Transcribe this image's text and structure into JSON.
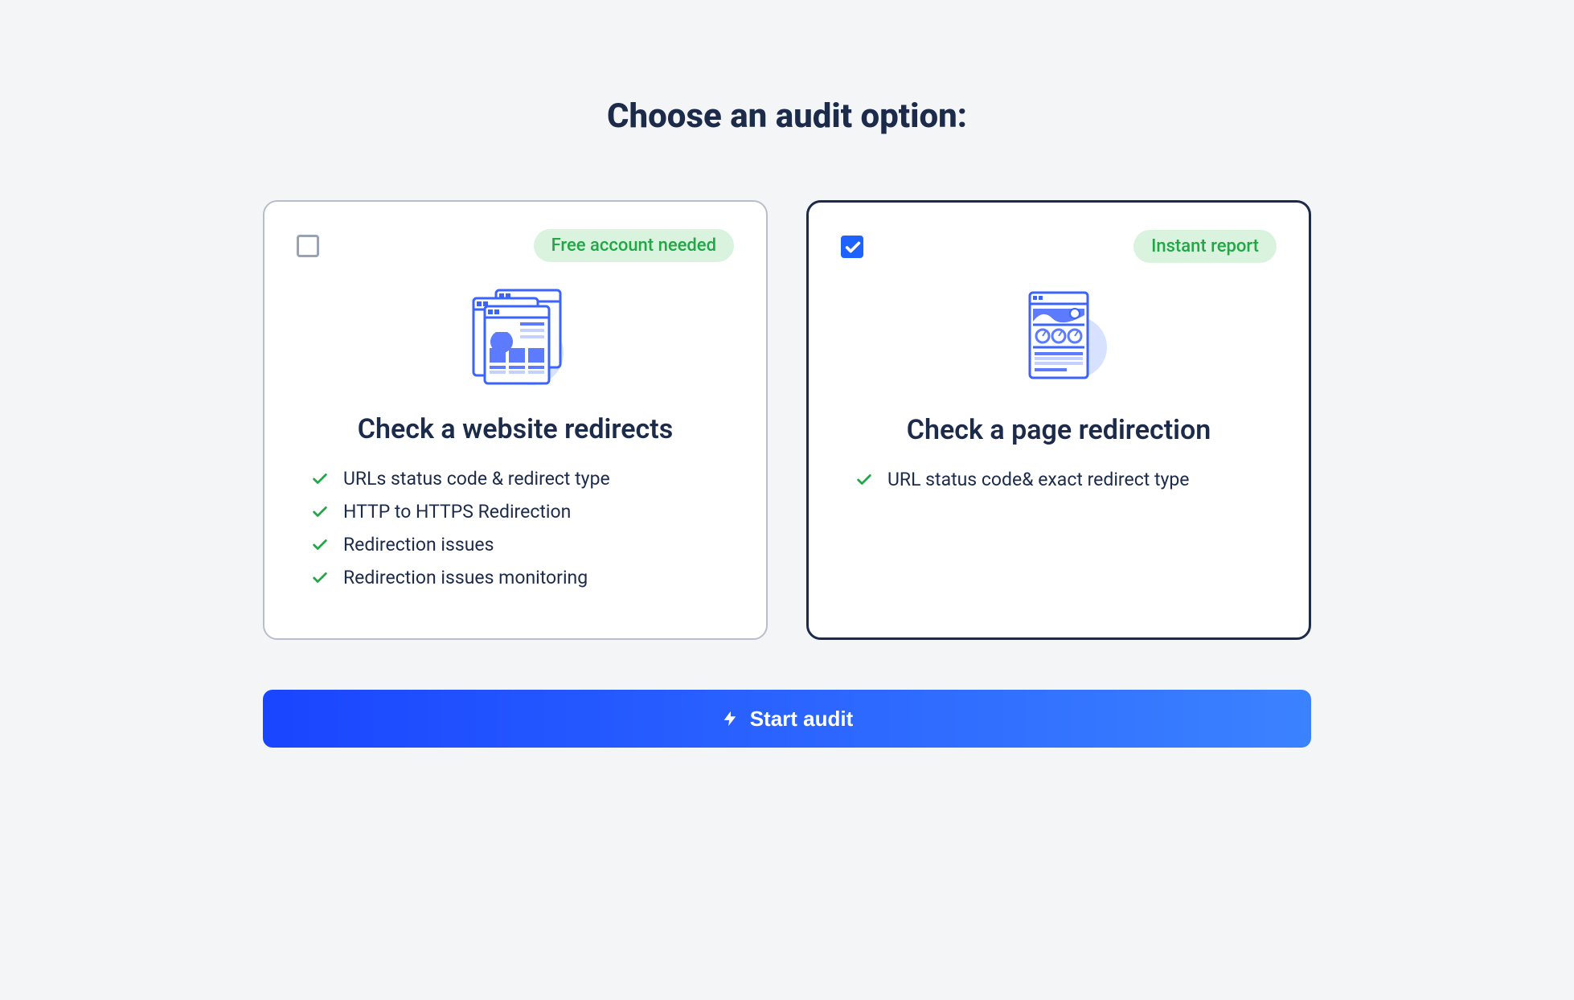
{
  "page_title": "Choose an audit option:",
  "cards": [
    {
      "badge": "Free account needed",
      "title": "Check a website redirects",
      "selected": false,
      "features": [
        "URLs status code & redirect type",
        "HTTP to HTTPS Redirection",
        "Redirection issues",
        "Redirection issues monitoring"
      ]
    },
    {
      "badge": "Instant report",
      "title": "Check a page redirection",
      "selected": true,
      "features": [
        "URL status code& exact redirect type"
      ]
    }
  ],
  "start_button_label": "Start audit"
}
